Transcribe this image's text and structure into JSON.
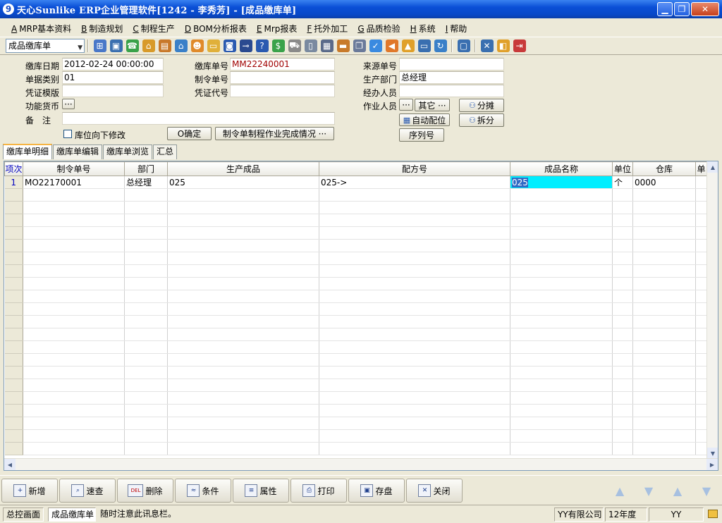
{
  "window": {
    "title": "天心Sunlike ERP企业管理软件[1242 - 李秀芳] - [成品缴库单]",
    "app_icon": "9",
    "minimize": "▁",
    "restore": "❐",
    "close": "✕"
  },
  "menu": [
    {
      "key": "A",
      "label": "MRP基本资料"
    },
    {
      "key": "B",
      "label": "制造规划"
    },
    {
      "key": "C",
      "label": "制程生产"
    },
    {
      "key": "D",
      "label": "BOM分析报表"
    },
    {
      "key": "E",
      "label": "Mrp报表"
    },
    {
      "key": "F",
      "label": "托外加工"
    },
    {
      "key": "G",
      "label": "品质检验"
    },
    {
      "key": "H",
      "label": "系统"
    },
    {
      "key": "I",
      "label": "帮助"
    }
  ],
  "toolbar": {
    "form_selector": "成品缴库单",
    "icons": [
      {
        "name": "tree-icon",
        "glyph": "⊞",
        "color": "#4a78c8"
      },
      {
        "name": "monitor-icon",
        "glyph": "▣",
        "color": "#3a6fb0"
      },
      {
        "name": "phone-icon",
        "glyph": "☎",
        "color": "#3aa24a"
      },
      {
        "name": "home-lock-icon",
        "glyph": "⌂",
        "color": "#d89a2a"
      },
      {
        "name": "briefcase-icon",
        "glyph": "▤",
        "color": "#c8782a"
      },
      {
        "name": "house-icon",
        "glyph": "⌂",
        "color": "#3a80c8"
      },
      {
        "name": "people-icon",
        "glyph": "☻",
        "color": "#e08a2a"
      },
      {
        "name": "folder-icon",
        "glyph": "▭",
        "color": "#e0b03a"
      },
      {
        "name": "book-icon",
        "glyph": "◙",
        "color": "#2a5ab0"
      },
      {
        "name": "key-icon",
        "glyph": "⊸",
        "color": "#2a4a90"
      },
      {
        "name": "help-icon",
        "glyph": "?",
        "color": "#2a5ab0"
      },
      {
        "name": "dollar-icon",
        "glyph": "$",
        "color": "#3aa24a"
      },
      {
        "name": "cart-icon",
        "glyph": "⛟",
        "color": "#8a8a8a"
      },
      {
        "name": "document-icon",
        "glyph": "▯",
        "color": "#7a8aa0"
      },
      {
        "name": "calculator-icon",
        "glyph": "▦",
        "color": "#5a6a8a"
      },
      {
        "name": "drawer-icon",
        "glyph": "▬",
        "color": "#c87a2a"
      },
      {
        "name": "copy-icon",
        "glyph": "❐",
        "color": "#6a7a9a"
      },
      {
        "name": "check-circle-icon",
        "glyph": "✓",
        "color": "#3a8ae0"
      },
      {
        "name": "announce-icon",
        "glyph": "◀",
        "color": "#e0782a"
      },
      {
        "name": "hierarchy-icon",
        "glyph": "▲",
        "color": "#e0a02a"
      },
      {
        "name": "screen-icon",
        "glyph": "▭",
        "color": "#3a6fb0"
      },
      {
        "name": "refresh-icon",
        "glyph": "↻",
        "color": "#3a80c8"
      },
      {
        "name": "window-icon",
        "glyph": "▢",
        "color": "#3a6fb0"
      },
      {
        "name": "close-doc-icon",
        "glyph": "✕",
        "color": "#3a6fb0"
      },
      {
        "name": "windows-icon",
        "glyph": "◧",
        "color": "#e0a02a"
      },
      {
        "name": "exit-icon",
        "glyph": "⇥",
        "color": "#c83a3a"
      }
    ]
  },
  "form": {
    "date_label": "缴库日期",
    "date_value": "2012-02-24 00:00:00",
    "doc_no_label": "缴库单号",
    "doc_no_value": "MM22240001",
    "source_no_label": "来源单号",
    "source_no_value": "",
    "category_label": "单据类别",
    "category_value": "01",
    "order_no_label": "制令单号",
    "order_no_value": "",
    "dept_label": "生产部门",
    "dept_value": "总经理",
    "template_label": "凭证模版",
    "template_value": "",
    "voucher_code_label": "凭证代号",
    "voucher_code_value": "",
    "handler_label": "经办人员",
    "handler_value": "",
    "currency_label": "功能货币",
    "currency_btn": "···",
    "operator_label": "作业人员",
    "operator_btn": "···",
    "other_btn": "其它 ···",
    "split_share_btn": "分摊",
    "remark_label": "备　注",
    "remark_value": "",
    "auto_assign_btn": "自动配位",
    "split_btn": "拆分",
    "location_checkbox": "库位向下修改",
    "confirm_btn": "O确定",
    "progress_btn": "制令单制程作业完成情况 ···",
    "serial_btn": "序列号"
  },
  "tabs": [
    "缴库单明细",
    "缴库单编辑",
    "缴库单浏览",
    "汇总"
  ],
  "grid": {
    "columns": [
      "项次",
      "制令单号",
      "部门",
      "生产成品",
      "配方号",
      "成品名称",
      "单位",
      "仓库",
      "单"
    ],
    "rows": [
      [
        "1",
        "MO22170001",
        "总经理",
        "025",
        "025->",
        "025",
        "个",
        "0000",
        ""
      ]
    ],
    "empty_row_count": 21
  },
  "bottom_buttons": [
    {
      "name": "new-button",
      "label": "新增",
      "icon": "+",
      "icon_name": "new-icon"
    },
    {
      "name": "quick-search-button",
      "label": "速查",
      "icon": "⌕",
      "icon_name": "search-icon"
    },
    {
      "name": "delete-button",
      "label": "删除",
      "icon": "DEL",
      "icon_name": "delete-icon"
    },
    {
      "name": "condition-button",
      "label": "条件",
      "icon": "≈",
      "icon_name": "condition-icon"
    },
    {
      "name": "properties-button",
      "label": "属性",
      "icon": "≡",
      "icon_name": "properties-icon"
    },
    {
      "name": "print-button",
      "label": "打印",
      "icon": "⎙",
      "icon_name": "print-icon"
    },
    {
      "name": "save-button",
      "label": "存盘",
      "icon": "▣",
      "icon_name": "save-icon"
    },
    {
      "name": "close-button",
      "label": "关闭",
      "icon": "✕",
      "icon_name": "close-icon"
    }
  ],
  "nav_buttons": [
    "▲",
    "▼",
    "▲",
    "▼"
  ],
  "status": {
    "home": "总控画面",
    "current": "成品缴库单",
    "message": "随时注意此讯息栏。",
    "company": "YY有限公司",
    "year": "12年度",
    "user": "YY"
  }
}
